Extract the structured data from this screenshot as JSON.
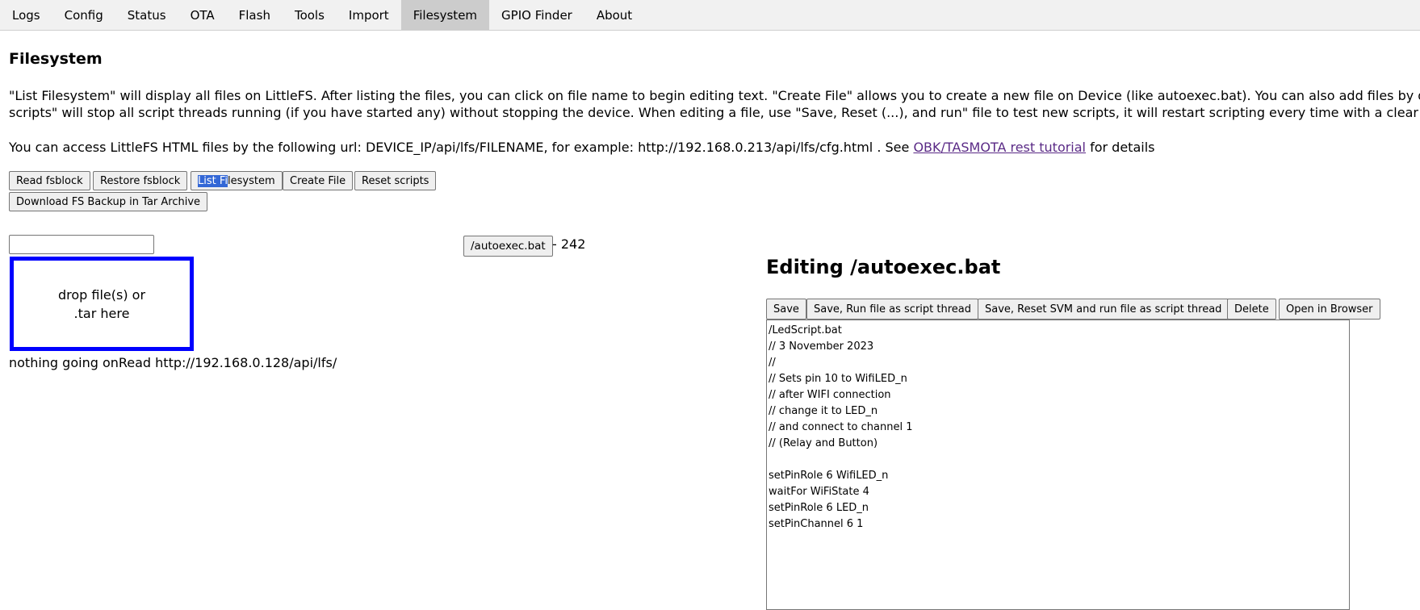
{
  "tabs": [
    "Logs",
    "Config",
    "Status",
    "OTA",
    "Flash",
    "Tools",
    "Import",
    "Filesystem",
    "GPIO Finder",
    "About"
  ],
  "active_tab": "Filesystem",
  "page": {
    "title": "Filesystem",
    "description_line1": "\"List Filesystem\" will display all files on LittleFS. After listing the files, you can click on file name to begin editing text. \"Create File\" allows you to create a new file on Device (like autoexec.bat). You can also add files by drag & dro",
    "description_line2": "scripts\" will stop all script threads running (if you have started any) without stopping the device. When editing a file, use \"Save, Reset (...), and run\" file to test new scripts, it will restart scripting every time with a clear state.",
    "url_text_before": "You can access LittleFS HTML files by the following url: DEVICE_IP/api/lfs/FILENAME, for example: http://192.168.0.213/api/lfs/cfg.html . See ",
    "url_link": "OBK/TASMOTA rest tutorial",
    "url_text_after": " for details"
  },
  "buttons": {
    "read_fsblock": "Read fsblock",
    "restore_fsblock": "Restore fsblock",
    "list_filesystem_selected": "List Fi",
    "list_filesystem_rest": "lesystem",
    "create_file": "Create File",
    "reset_scripts": "Reset scripts",
    "download_backup": "Download FS Backup in Tar Archive"
  },
  "file_list": {
    "name_input_value": "",
    "dropzone_line1": "drop file(s) or",
    "dropzone_line2": ".tar here",
    "status": "nothing going onRead http://192.168.0.128/api/lfs/",
    "files": [
      {
        "name": "/autoexec.bat",
        "size_text": "- 242"
      }
    ]
  },
  "editor": {
    "title": "Editing /autoexec.bat",
    "buttons": {
      "save": "Save",
      "save_run": "Save, Run file as script thread",
      "save_reset_run": "Save, Reset SVM and run file as script thread",
      "delete": "Delete",
      "open_browser": "Open in Browser"
    },
    "content": "/LedScript.bat\n// 3 November 2023\n//\n// Sets pin 10 to WifiLED_n\n// after WIFI connection\n// change it to LED_n\n// and connect to channel 1\n// (Relay and Button)\n\nsetPinRole 6 WifiLED_n\nwaitFor WiFiState 4\nsetPinRole 6 LED_n\nsetPinChannel 6 1"
  },
  "colors": {
    "tabbar_bg": "#f1f1f1",
    "active_tab_bg": "#cccccc",
    "dropzone_border": "#0000ff",
    "link": "#5a2a86",
    "selection": "#3367d6"
  }
}
